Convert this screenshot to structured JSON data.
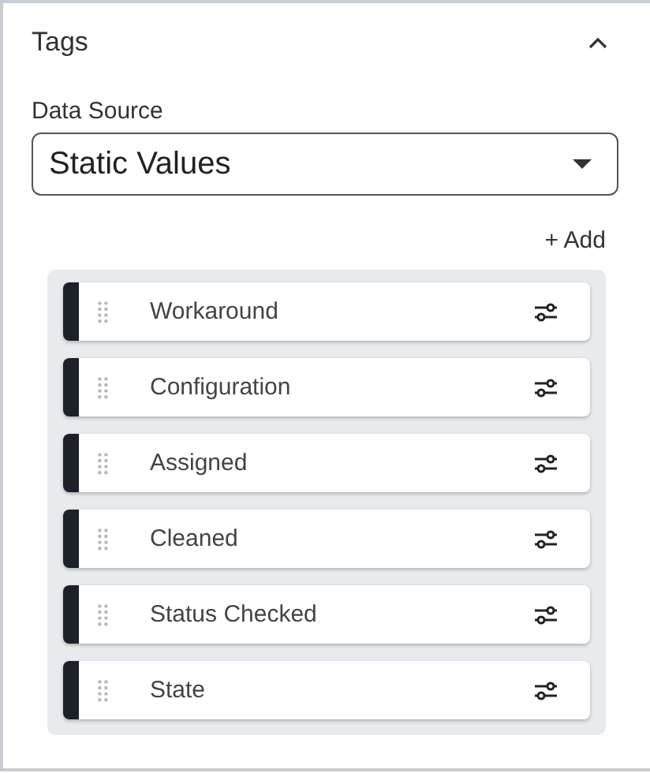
{
  "section": {
    "title": "Tags",
    "expanded": true
  },
  "data_source": {
    "label": "Data Source",
    "value": "Static Values"
  },
  "add_button": "+ Add",
  "tags": [
    {
      "label": "Workaround"
    },
    {
      "label": "Configuration"
    },
    {
      "label": "Assigned"
    },
    {
      "label": "Cleaned"
    },
    {
      "label": "Status Checked"
    },
    {
      "label": "State"
    }
  ]
}
